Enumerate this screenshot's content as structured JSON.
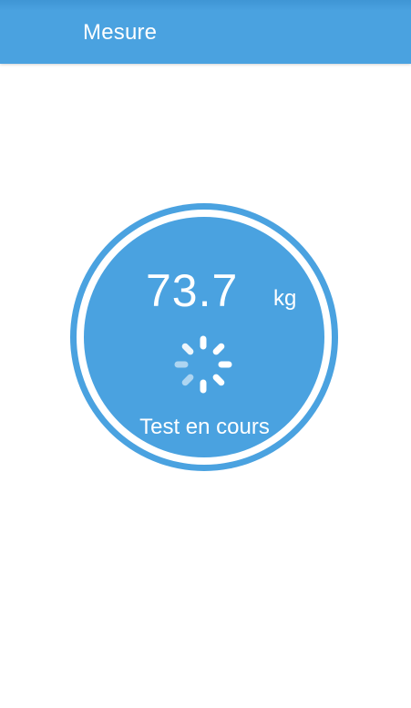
{
  "header": {
    "title": "Mesure"
  },
  "measurement": {
    "value": "73.7",
    "unit": "kg",
    "status": "Test en cours",
    "loading_icon": "spinner-icon"
  },
  "colors": {
    "primary": "#4aa2e0",
    "text_on_primary": "#ffffff",
    "background": "#ffffff"
  }
}
